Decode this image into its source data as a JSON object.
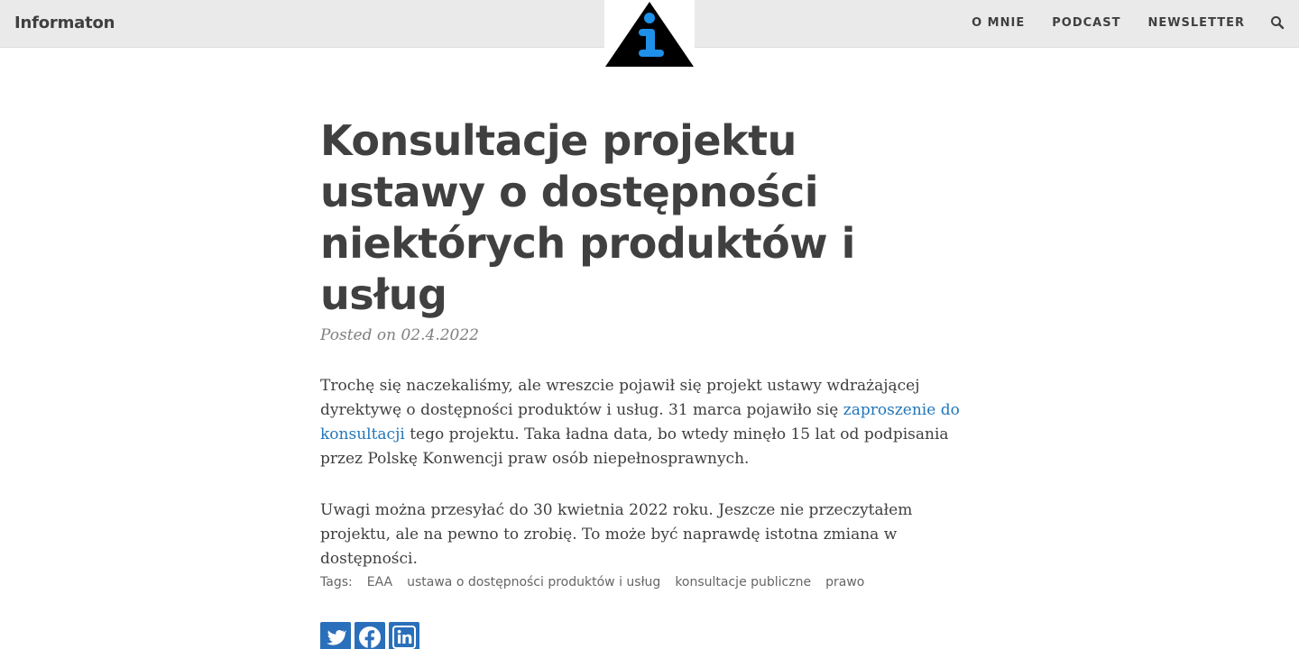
{
  "navbar": {
    "brand": "Informaton",
    "logo_icon": "info-triangle-logo",
    "links": [
      "O MNIE",
      "PODCAST",
      "NEWSLETTER"
    ],
    "search_icon": "search-icon"
  },
  "post": {
    "title": "Konsultacje projektu ustawy o dostępności niektórych produktów i usług",
    "meta": "Posted on 02.4.2022",
    "paragraph1": {
      "before_link": "Trochę się naczekaliśmy, ale wreszcie pojawił się projekt ustawy wdrażającej dyrektywę o dostępności produktów i usług. 31 marca pojawiło się ",
      "link_text": "zaproszenie do konsultacji",
      "after_link": " tego projektu. Taka ładna data, bo wtedy minęło 15 lat od podpisania przez Polskę Konwencji praw osób niepełnosprawnych."
    },
    "paragraph2": "Uwagi można przesyłać do 30 kwietnia 2022 roku. Jeszcze nie przeczytałem projektu, ale na pewno to zrobię. To może być naprawdę istotna zmiana w dostępności.",
    "tags_label": "Tags:",
    "tags": [
      "EAA",
      "ustawa o dostępności produktów i usług",
      "konsultacje publiczne",
      "prawo"
    ]
  },
  "share": {
    "buttons": [
      "twitter-icon",
      "facebook-icon",
      "linkedin-icon"
    ],
    "color": "#2a6fba"
  },
  "colors": {
    "navbar_bg": "#eaeaea",
    "text": "#404040",
    "link": "#2277bb",
    "meta": "#808080",
    "logo_blue": "#1e90e8"
  }
}
